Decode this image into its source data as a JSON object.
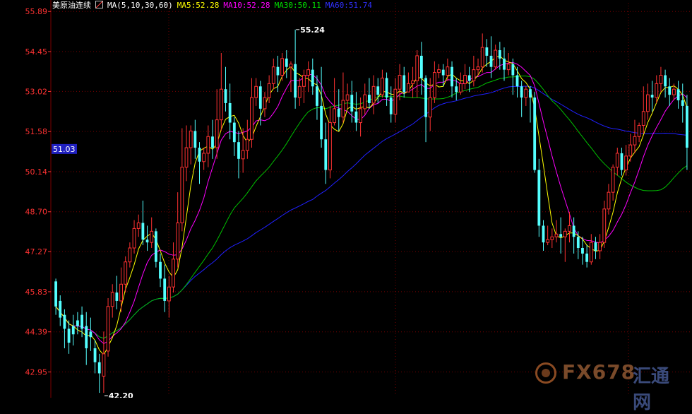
{
  "legend": {
    "title": "美原油连续",
    "ma_label": "MA(5,10,30,60)",
    "ma5": "MA5:52.28",
    "ma10": "MA10:52.28",
    "ma30": "MA30:50.11",
    "ma60": "MA60:51.74"
  },
  "watermark": {
    "text": "FX678",
    "cn": "汇通网"
  },
  "colors": {
    "background": "#000000",
    "up": "#ff3232",
    "down": "#54ffff",
    "ma5": "#ffff00",
    "ma10": "#ff00ff",
    "ma30": "#00c000",
    "ma60": "#2020ff",
    "axis_text": "#ff3232",
    "grid": "#7a0000"
  },
  "chart_data": {
    "type": "candlestick",
    "y_ticks": [
      "55.89",
      "54.45",
      "53.02",
      "51.58",
      "50.14",
      "48.70",
      "47.27",
      "45.83",
      "44.39",
      "42.95"
    ],
    "ylim": [
      42.1,
      56.2
    ],
    "annotations": [
      {
        "label": "55.24",
        "value": 55.24,
        "type": "high"
      },
      {
        "label": "42.20",
        "value": 42.2,
        "type": "low"
      }
    ],
    "current_price_label": "51.03",
    "grid": "dotted",
    "ohlc": [
      [
        46.2,
        45.3,
        46.3,
        45.0
      ],
      [
        45.5,
        44.9,
        45.7,
        44.6
      ],
      [
        45.0,
        44.5,
        45.2,
        43.8
      ],
      [
        44.5,
        44.0,
        44.8,
        43.6
      ],
      [
        44.6,
        44.3,
        45.0,
        43.9
      ],
      [
        44.8,
        44.6,
        45.1,
        44.3
      ],
      [
        45.0,
        44.5,
        45.3,
        44.2
      ],
      [
        44.6,
        43.8,
        45.1,
        43.2
      ],
      [
        44.4,
        44.2,
        44.9,
        43.7
      ],
      [
        43.8,
        43.3,
        44.1,
        42.9
      ],
      [
        43.3,
        42.9,
        43.6,
        42.2
      ],
      [
        42.8,
        43.6,
        44.4,
        42.2
      ],
      [
        43.7,
        45.3,
        45.6,
        43.5
      ],
      [
        45.3,
        45.8,
        46.1,
        44.9
      ],
      [
        45.8,
        45.5,
        46.4,
        45.2
      ],
      [
        45.5,
        46.1,
        46.7,
        45.1
      ],
      [
        46.1,
        46.9,
        47.1,
        45.8
      ],
      [
        46.9,
        47.4,
        47.6,
        46.7
      ],
      [
        47.4,
        48.1,
        48.4,
        47.2
      ],
      [
        48.1,
        48.3,
        48.6,
        47.8
      ],
      [
        48.3,
        47.7,
        49.1,
        47.5
      ],
      [
        47.7,
        47.6,
        48.2,
        47.3
      ],
      [
        47.6,
        48.0,
        48.5,
        47.4
      ],
      [
        48.0,
        46.9,
        48.1,
        46.7
      ],
      [
        46.9,
        46.3,
        47.2,
        46.0
      ],
      [
        46.3,
        45.5,
        46.8,
        45.1
      ],
      [
        45.5,
        46.0,
        46.4,
        44.9
      ],
      [
        46.0,
        47.0,
        47.6,
        45.8
      ],
      [
        47.0,
        48.3,
        49.4,
        46.7
      ],
      [
        48.3,
        50.3,
        51.7,
        48.0
      ],
      [
        50.3,
        51.0,
        51.8,
        49.8
      ],
      [
        51.0,
        51.6,
        51.8,
        50.4
      ],
      [
        51.6,
        51.0,
        52.0,
        50.6
      ],
      [
        51.0,
        50.5,
        51.2,
        49.7
      ],
      [
        50.5,
        50.8,
        51.0,
        50.2
      ],
      [
        50.8,
        51.4,
        51.8,
        50.3
      ],
      [
        51.4,
        51.0,
        52.0,
        50.6
      ],
      [
        51.0,
        52.0,
        53.1,
        50.6
      ],
      [
        52.0,
        53.1,
        54.4,
        51.6
      ],
      [
        53.1,
        52.6,
        53.9,
        52.3
      ],
      [
        52.6,
        51.9,
        53.3,
        51.3
      ],
      [
        51.9,
        51.2,
        52.1,
        50.7
      ],
      [
        51.2,
        50.6,
        51.6,
        49.9
      ],
      [
        50.6,
        50.9,
        51.7,
        50.1
      ],
      [
        50.9,
        51.3,
        52.0,
        50.6
      ],
      [
        51.3,
        52.8,
        53.5,
        51.0
      ],
      [
        52.8,
        53.2,
        53.5,
        52.5
      ],
      [
        53.2,
        52.4,
        53.4,
        51.8
      ],
      [
        52.4,
        52.8,
        53.0,
        52.1
      ],
      [
        52.8,
        53.3,
        53.6,
        52.6
      ],
      [
        53.3,
        53.9,
        54.2,
        53.1
      ],
      [
        53.9,
        53.6,
        54.3,
        53.0
      ],
      [
        53.6,
        54.2,
        54.4,
        53.4
      ],
      [
        54.2,
        53.9,
        54.5,
        53.5
      ],
      [
        53.9,
        54.0,
        54.1,
        53.0
      ],
      [
        54.0,
        52.8,
        55.24,
        52.4
      ],
      [
        52.8,
        53.2,
        53.5,
        52.5
      ],
      [
        53.2,
        53.6,
        53.8,
        52.6
      ],
      [
        53.6,
        53.8,
        54.1,
        53.0
      ],
      [
        53.8,
        53.2,
        54.2,
        52.9
      ],
      [
        53.2,
        52.5,
        53.6,
        52.0
      ],
      [
        52.5,
        51.3,
        53.9,
        51.0
      ],
      [
        51.3,
        50.2,
        51.9,
        49.7
      ],
      [
        50.2,
        51.9,
        52.5,
        49.9
      ],
      [
        51.9,
        52.4,
        53.5,
        51.8
      ],
      [
        52.4,
        52.1,
        53.1,
        51.6
      ],
      [
        52.1,
        52.7,
        53.7,
        51.9
      ],
      [
        52.7,
        52.9,
        53.3,
        52.4
      ],
      [
        52.9,
        52.3,
        53.4,
        51.9
      ],
      [
        52.3,
        51.9,
        53.0,
        51.6
      ],
      [
        51.9,
        52.4,
        52.8,
        51.4
      ],
      [
        52.4,
        52.9,
        53.3,
        52.2
      ],
      [
        52.9,
        52.6,
        53.5,
        52.4
      ],
      [
        52.6,
        53.2,
        53.6,
        52.2
      ],
      [
        53.2,
        52.9,
        53.5,
        52.6
      ],
      [
        52.9,
        53.5,
        53.8,
        52.8
      ],
      [
        53.5,
        52.8,
        53.7,
        52.5
      ],
      [
        52.8,
        52.2,
        53.2,
        51.9
      ],
      [
        52.2,
        53.1,
        53.5,
        51.9
      ],
      [
        53.1,
        53.6,
        54.0,
        52.7
      ],
      [
        53.6,
        53.0,
        53.9,
        52.8
      ],
      [
        53.0,
        53.3,
        53.7,
        53.0
      ],
      [
        53.3,
        53.4,
        53.9,
        52.8
      ],
      [
        53.4,
        54.3,
        54.5,
        52.8
      ],
      [
        54.3,
        53.5,
        54.8,
        52.9
      ],
      [
        53.5,
        52.1,
        53.6,
        51.2
      ],
      [
        52.1,
        52.8,
        53.5,
        51.6
      ],
      [
        52.8,
        53.7,
        54.1,
        52.6
      ],
      [
        53.7,
        53.8,
        54.0,
        53.5
      ],
      [
        53.8,
        53.6,
        54.0,
        53.2
      ],
      [
        53.6,
        53.9,
        54.2,
        53.4
      ],
      [
        53.9,
        53.2,
        54.1,
        52.8
      ],
      [
        53.2,
        53.0,
        53.5,
        52.7
      ],
      [
        53.0,
        53.3,
        53.7,
        52.9
      ],
      [
        53.3,
        53.6,
        54.0,
        53.1
      ],
      [
        53.6,
        53.4,
        53.9,
        53.0
      ],
      [
        53.4,
        53.8,
        54.3,
        53.2
      ],
      [
        53.8,
        53.9,
        54.2,
        53.6
      ],
      [
        53.9,
        54.6,
        55.1,
        53.7
      ],
      [
        54.6,
        54.3,
        54.9,
        53.9
      ],
      [
        54.3,
        53.9,
        55.0,
        53.5
      ],
      [
        53.9,
        54.5,
        54.7,
        53.8
      ],
      [
        54.5,
        54.2,
        54.8,
        53.8
      ],
      [
        54.2,
        53.8,
        54.6,
        53.4
      ],
      [
        53.8,
        54.0,
        54.4,
        53.6
      ],
      [
        54.0,
        53.6,
        54.2,
        52.9
      ],
      [
        53.6,
        53.2,
        53.9,
        52.8
      ],
      [
        53.2,
        52.8,
        53.4,
        52.1
      ],
      [
        52.8,
        53.1,
        53.2,
        52.5
      ],
      [
        53.1,
        52.8,
        53.2,
        51.9
      ],
      [
        52.8,
        50.2,
        53.0,
        50.1
      ],
      [
        50.2,
        48.2,
        50.6,
        47.8
      ],
      [
        48.2,
        47.6,
        48.4,
        47.3
      ],
      [
        47.6,
        47.7,
        48.2,
        47.5
      ],
      [
        47.7,
        47.8,
        48.1,
        47.4
      ],
      [
        47.8,
        47.9,
        48.4,
        47.6
      ],
      [
        47.9,
        47.8,
        48.5,
        47.2
      ],
      [
        47.8,
        48.0,
        48.1,
        46.9
      ],
      [
        48.0,
        48.2,
        48.7,
        47.6
      ],
      [
        48.2,
        47.8,
        48.5,
        47.2
      ],
      [
        47.8,
        47.4,
        48.0,
        47.0
      ],
      [
        47.4,
        47.2,
        47.8,
        46.8
      ],
      [
        47.2,
        46.9,
        47.5,
        46.7
      ],
      [
        46.9,
        47.6,
        47.9,
        46.8
      ],
      [
        47.6,
        47.3,
        47.8,
        47.0
      ],
      [
        47.3,
        47.6,
        47.9,
        47.0
      ],
      [
        47.6,
        48.8,
        49.1,
        47.4
      ],
      [
        48.8,
        49.4,
        49.7,
        48.6
      ],
      [
        49.4,
        50.3,
        50.4,
        49.1
      ],
      [
        50.3,
        50.8,
        51.0,
        50.0
      ],
      [
        50.8,
        50.2,
        51.0,
        50.0
      ],
      [
        50.2,
        50.7,
        51.1,
        50.0
      ],
      [
        50.7,
        51.1,
        51.5,
        50.5
      ],
      [
        51.1,
        51.4,
        52.0,
        50.8
      ],
      [
        51.4,
        51.8,
        51.9,
        51.2
      ],
      [
        51.8,
        52.3,
        53.2,
        51.5
      ],
      [
        52.3,
        52.9,
        53.3,
        52.0
      ],
      [
        52.9,
        52.8,
        53.4,
        52.3
      ],
      [
        52.8,
        53.3,
        53.6,
        52.6
      ],
      [
        53.3,
        53.6,
        53.9,
        53.0
      ],
      [
        53.6,
        53.2,
        53.8,
        52.8
      ],
      [
        53.2,
        52.9,
        53.5,
        52.5
      ],
      [
        52.9,
        53.1,
        53.3,
        52.7
      ],
      [
        53.1,
        52.7,
        53.4,
        52.4
      ],
      [
        52.7,
        52.5,
        53.3,
        51.9
      ],
      [
        52.5,
        51.0,
        52.9,
        50.2
      ]
    ]
  }
}
